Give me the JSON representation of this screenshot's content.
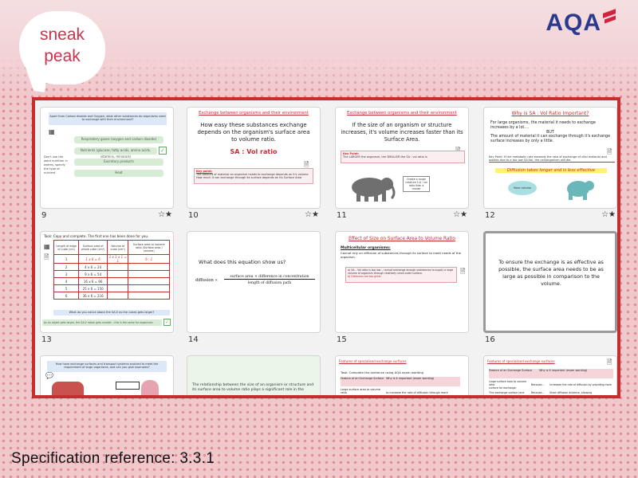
{
  "brand": {
    "logo_text": "AQA",
    "accent": "#c62d2f",
    "logo_color": "#2b3a8f"
  },
  "bubble": {
    "line1": "sneak",
    "line2": "peak"
  },
  "footer": {
    "spec_text": "Specification reference: 3.3.1"
  },
  "slides": [
    {
      "number": "9",
      "star": "☆★",
      "question": "Apart from Carbon dioxide and Oxygen, what other substances do organisms need to exchange with their environment?",
      "pill1": "Respiratory gases (oxygen and carbon dioxide)",
      "pill2": "Nutrients (glucose, fatty acids, amino acids, vitamins, minerals)",
      "pill3": "Excretory products",
      "pill4": "Heat",
      "side_note": "Don't use the word nutrition in exams, specify the type of nutrient"
    },
    {
      "number": "10",
      "star": "☆★",
      "title": "Exchange between organisms and their environment",
      "body": "How easy these substances exchange depends on the organism's surface area to volume ratio.",
      "highlight": "SA : Vol ratio",
      "key_title": "Key point:",
      "key1": "The amount of material an organism needs to exchange depends on it's volume",
      "key2": "How much it can exchange through its surface depends on its Surface Area"
    },
    {
      "number": "11",
      "star": "☆★",
      "title": "Exchange between organisms and their environment",
      "body": "If the size of an organism or structure increases, it's volume increases faster than its Surface Area.",
      "key_title": "Key Point:",
      "key": "The LARGER the organism, the SMALLER the SA : vol ratio is",
      "callout": "Create a rough creature S.A : vol ratio than a mouse"
    },
    {
      "number": "12",
      "star": "☆★",
      "title": "Why is SA : Vol Ratio Important?",
      "body1": "For large organisms, the material it needs to exchange increases by a lot....",
      "but": "BUT",
      "body2": "The amount of material it can exchange through it's exchange surface increases by only a little.",
      "key": "Key Point: If the metabolic rate exceeds the rate of exchange of vital material and wastes due to a too low SA:Vol, the cell/organism will die.",
      "highlight": "Diffusion takes longer and is less effective",
      "blob": "More volume"
    },
    {
      "number": "13",
      "task": "Task: Copy and complete. The first one has been done for you.",
      "headers": [
        "Length of edge of cube (cm)",
        "Surface area of whole cube (cm²)",
        "Volume of cube (cm³)",
        "Surface area to volume ratio (Surface area / volume)"
      ],
      "rows": [
        [
          "1",
          "1 x 6 = 6",
          "1 x 1 x 1 = 1",
          "6 : 1"
        ],
        [
          "2",
          "4 x 6 = 24",
          "",
          ""
        ],
        [
          "3",
          "9 x 6 = 54",
          "",
          ""
        ],
        [
          "4",
          "16 x 6 = 96",
          "",
          ""
        ],
        [
          "5",
          "25 x 6 = 150",
          "",
          ""
        ],
        [
          "6",
          "36 x 6 = 216",
          "",
          ""
        ]
      ],
      "question": "What do you notice about the SA:V as the cubes gets larger?",
      "answer": "As an object gets larger, the SA:V ration gets smaller – this is the same for organisms"
    },
    {
      "number": "14",
      "question": "What does this equation show us?",
      "eq_left": "diffusion ∝",
      "eq_top": "surface area × difference in concentration",
      "eq_bottom": "length of diffusion path"
    },
    {
      "number": "15",
      "title": "Effect of Size on Surface Area to Volume Ratio",
      "subtitle": "Multicellular organisms:",
      "body": "Cannot rely on diffusion of substances through its surface to meet needs of the organism.",
      "point_a": "a) SA – Vol ratio is too low – cannot exchange enough substances to supply a large volume of organism through relatively small outer surface.",
      "point_b": "b) Distances are too great"
    },
    {
      "number": "16",
      "body": "To ensure the exchange is as effective as possible, the surface area needs to be as large as possible in comparison to the volume."
    },
    {
      "number": "17",
      "question": "How have exchange surfaces and transport systems evolved to meet the requirement of large organisms, and can you give examples?"
    },
    {
      "number": "18",
      "body": "The relationship between the size of an organism or structure and its surface area to volume ratio plays a significant role in the"
    },
    {
      "number": "19",
      "title": "Features of specialised exchange surfaces",
      "task": "Task: Complete the sentence using AQA exam wording",
      "col1": "Feature of an Exchange Surface",
      "col2": "Why is it important (exam wording)",
      "row1": "Large surface area to volume ratio",
      "row1b": "to increase the rate of diffusion through more"
    },
    {
      "number": "20",
      "title": "Features of specialised exchange surfaces",
      "col1": "Feature of an Exchange Surface",
      "col2": "Why is it important (exam wording)",
      "row1": "Large surface area to volume ratio",
      "row1a": "Because...",
      "row1b": "Increases the rate of diffusion by providing more surface for exchange.",
      "row2": "Thin exchange surface (one",
      "row2a": "Because...",
      "row2b": "Short diffusion distance, allowing"
    }
  ]
}
